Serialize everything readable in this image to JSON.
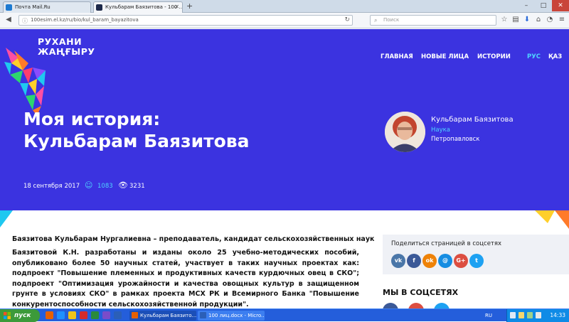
{
  "browser": {
    "tabs": [
      {
        "label": "Почта Mail.Ru",
        "active": false
      },
      {
        "label": "Кульбарам Баязитова - 100 ...",
        "active": true
      }
    ],
    "new_tab": "+",
    "url": "100esim.el.kz/ru/bio/kul_baram_bayazitova",
    "search_placeholder": "Поиск"
  },
  "site": {
    "logo_line1": "РУХАНИ",
    "logo_line2": "ЖАҢҒЫРУ",
    "nav": [
      "ГЛАВНАЯ",
      "НОВЫЕ ЛИЦА",
      "ИСТОРИИ"
    ],
    "lang_active": "РУС",
    "lang_other": "ҚАЗ"
  },
  "hero": {
    "title_line1": "Моя история:",
    "title_line2": "Кульбарам Баязитова",
    "author_name": "Кульбарам Баязитова",
    "author_category": "Наука",
    "author_city": "Петропавловск",
    "date": "18 сентября 2017",
    "comments": "1083",
    "views": "3231"
  },
  "article": {
    "lead": "Баязитова Кульбарам Нургалиевна – преподаватель, кандидат сельскохозяйственных наук",
    "paragraph": "Баязитовой К.Н. разработаны и изданы около 25 учебно-методических пособий, опубликовано более 50 научных статей, участвует в таких научных проектах как: подпроект \"Повышение племенных и продуктивных качеств курдючных овец в СКО\"; подпроект \"Оптимизация урожайности и качества овощных культур в защищенном грунте в условиях СКО\" в рамках проекта МСХ РК и Всемирного Банка \"Повышение конкурентоспособности сельскохозяйственной продукции\"."
  },
  "sidebar": {
    "share_title": "Поделиться страницей в соцсетях",
    "share_buttons": [
      {
        "name": "vk",
        "glyph": "vk",
        "color": "#4a76a8"
      },
      {
        "name": "facebook",
        "glyph": "f",
        "color": "#3b5998"
      },
      {
        "name": "odnoklassniki",
        "glyph": "ok",
        "color": "#ee8208"
      },
      {
        "name": "mailru",
        "glyph": "@",
        "color": "#168de2"
      },
      {
        "name": "googleplus",
        "glyph": "G+",
        "color": "#dc4e41"
      },
      {
        "name": "twitter",
        "glyph": "t",
        "color": "#1da1f2"
      }
    ],
    "follow_title": "МЫ В СОЦСЕТЯХ"
  },
  "taskbar": {
    "start": "пуск",
    "windows": [
      {
        "label": "Кульбарам Баязито..."
      },
      {
        "label": "100 лиц.docx - Micro..."
      }
    ],
    "lang": "RU",
    "clock": "14:33"
  }
}
